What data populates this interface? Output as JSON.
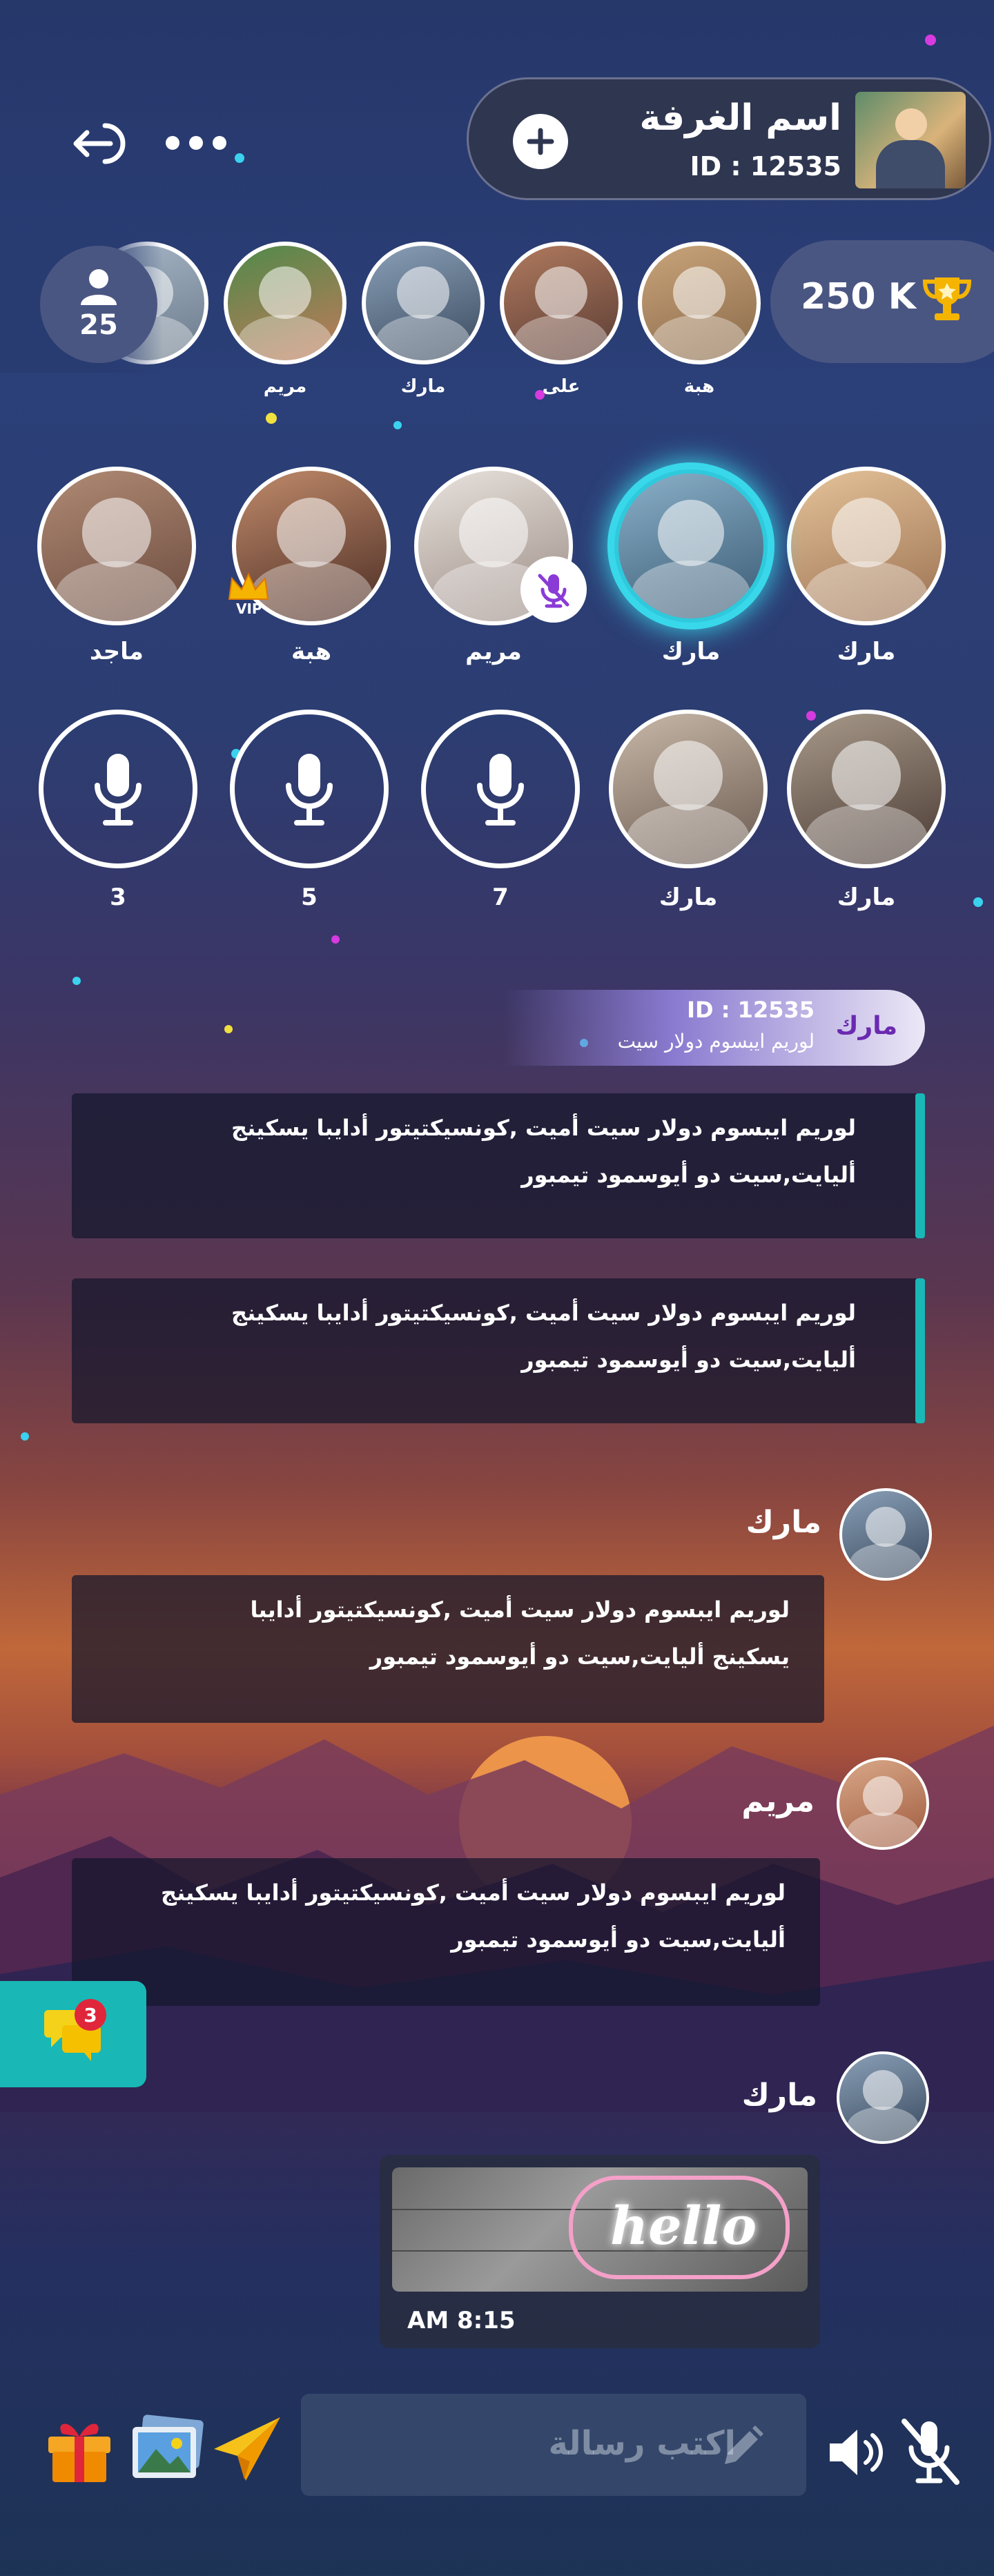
{
  "room": {
    "name": "اسم الغرفة",
    "id_label": "ID : 12535"
  },
  "top_icons": {
    "exit": "exit-icon",
    "more": "more-icon",
    "add": "add-icon"
  },
  "score": {
    "value": "250 K",
    "icon": "trophy-icon"
  },
  "audience": {
    "count": "25",
    "members": [
      {
        "name": "هبة"
      },
      {
        "name": "على"
      },
      {
        "name": "مارك"
      },
      {
        "name": "مريم"
      }
    ]
  },
  "seats_row1": [
    {
      "name": "مارك",
      "state": "normal"
    },
    {
      "name": "مارك",
      "state": "speaking"
    },
    {
      "name": "مريم",
      "state": "muted"
    },
    {
      "name": "هبة",
      "state": "vip",
      "badge": "VIP"
    },
    {
      "name": "ماجد",
      "state": "normal"
    }
  ],
  "seats_row2": [
    {
      "name": "مارك",
      "type": "user"
    },
    {
      "name": "مارك",
      "type": "user"
    },
    {
      "name": "7",
      "type": "empty"
    },
    {
      "name": "5",
      "type": "empty"
    },
    {
      "name": "3",
      "type": "empty"
    }
  ],
  "join_notice": {
    "name": "مارك",
    "id_label": "ID : 12535",
    "text": "لوريم ايبسوم دولار سيت"
  },
  "system_messages": [
    {
      "line1": "لوريم ايبسوم دولار سيت أميت ,كونسيكتيتور أدايبا يسكينج",
      "line2": "أليايت,سيت دو أيوسمود تيمبور"
    },
    {
      "line1": "لوريم ايبسوم دولار سيت أميت ,كونسيكتيتور أدايبا يسكينج",
      "line2": "أليايت,سيت دو أيوسمود تيمبور"
    }
  ],
  "chat": [
    {
      "sender": "مارك",
      "line1": "لوريم ايبسوم دولار سيت أميت ,كونسيكتيتور أدايبا",
      "line2": "يسكينج أليايت,سيت دو أيوسمود تيمبور"
    },
    {
      "sender": "مريم",
      "line1": "لوريم ايبسوم دولار سيت أميت ,كونسيكتيتور أدايبا يسكينج",
      "line2": "أليايت,سيت دو أيوسمود تيمبور"
    },
    {
      "sender": "مارك",
      "image_text": "hello",
      "time": "AM 8:15"
    }
  ],
  "notifications": {
    "count": "3"
  },
  "composer": {
    "placeholder": "اكتب رسالة",
    "icons": [
      "gift-icon",
      "gallery-icon",
      "send-icon",
      "pencil-icon",
      "speaker-icon",
      "mic-off-icon"
    ]
  },
  "colors": {
    "accent": "#19b7b5",
    "speaking_ring": "#39d7ea",
    "muted_badge": "#8a3bd6",
    "trophy": "#f4b400",
    "notification_badge": "#e0263b"
  }
}
